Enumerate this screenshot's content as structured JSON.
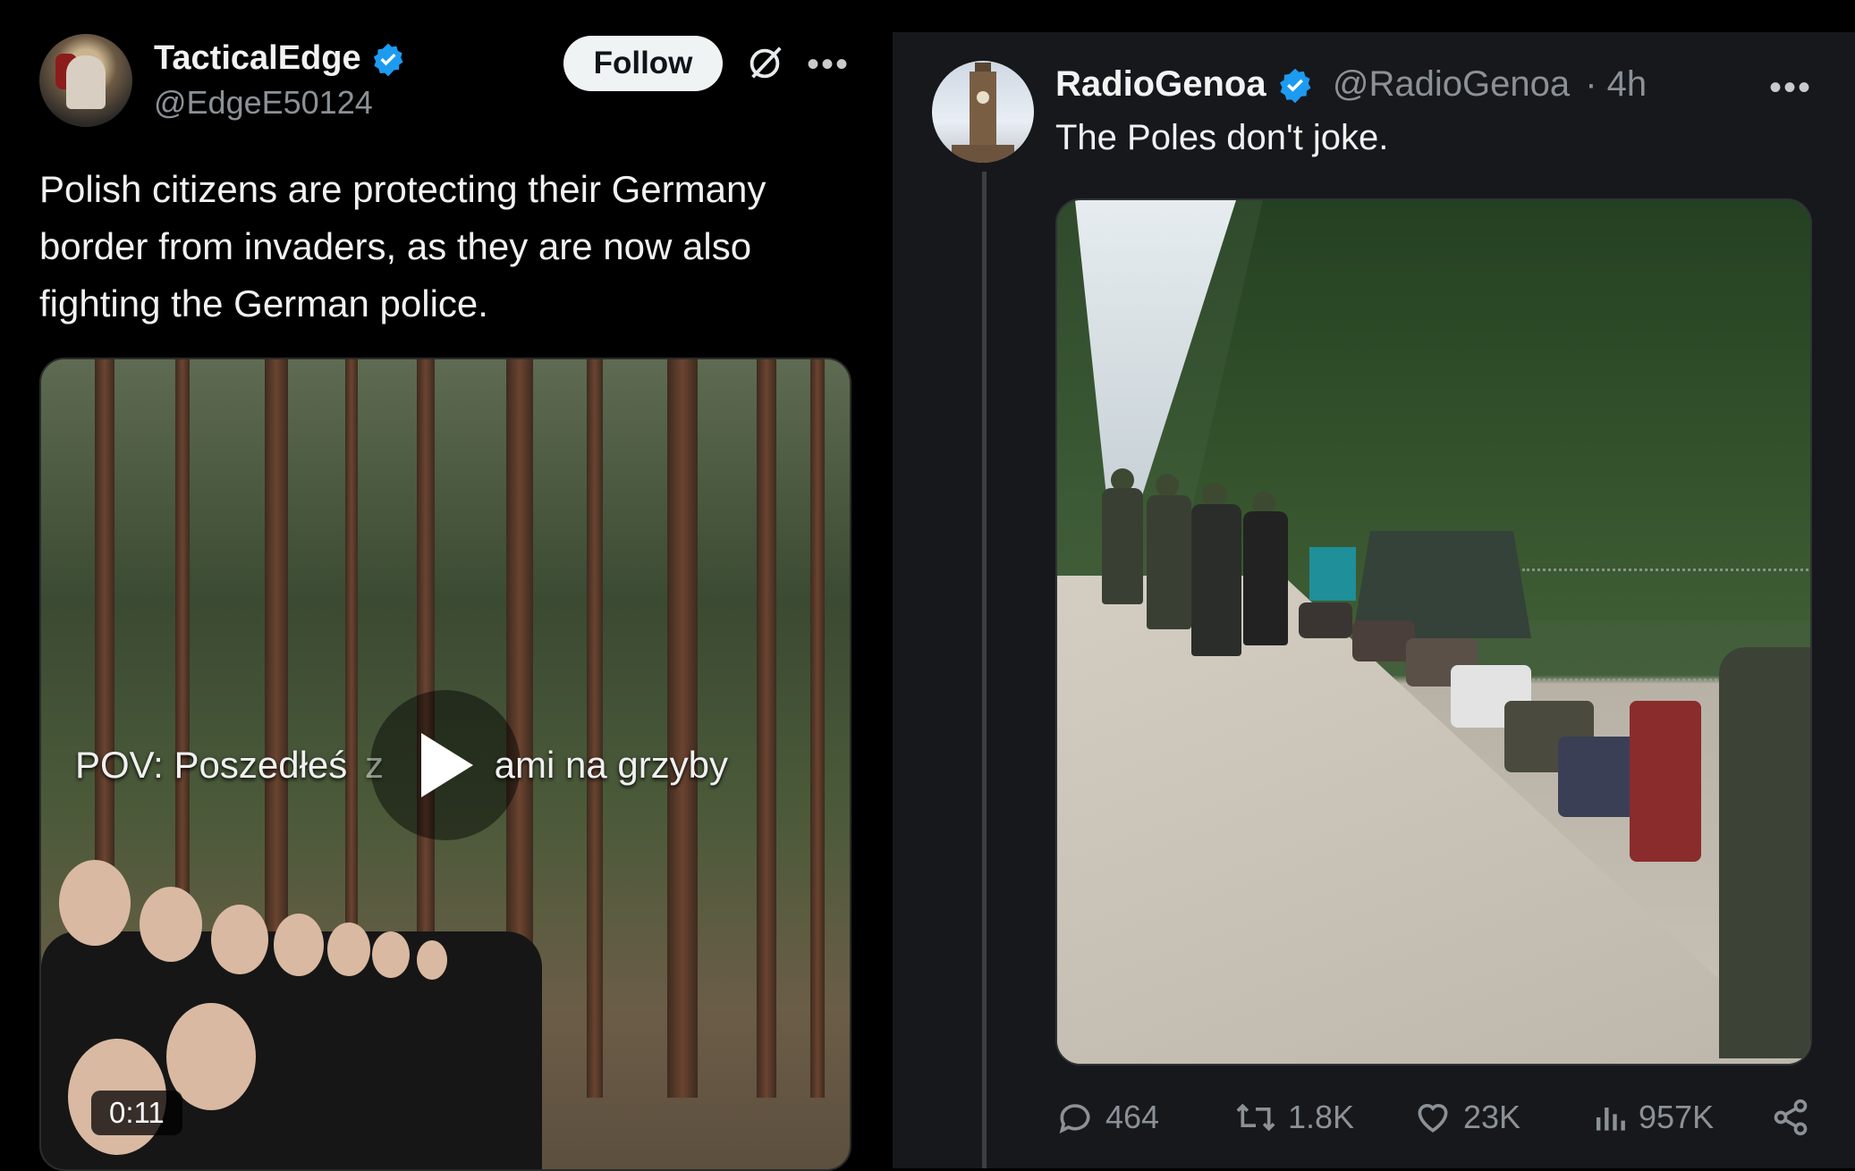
{
  "left_tweet": {
    "display_name": "TacticalEdge",
    "handle": "@EdgeE50124",
    "verified": true,
    "follow_label": "Follow",
    "text": "Polish citizens are protecting their Germany border from invaders, as they are now also fighting the German police.",
    "video": {
      "overlay_text": "POV: Poszedłeś z kolegami na grzyby",
      "overlay_visible_left": "POV: Poszedłeś",
      "overlay_visible_z": "z",
      "overlay_visible_right": "ami na grzyby",
      "duration": "0:11"
    }
  },
  "right_tweet": {
    "display_name": "RadioGenoa",
    "handle": "@RadioGenoa",
    "time": "· 4h",
    "verified": true,
    "text": "The Poles don't joke.",
    "stats": {
      "replies": "464",
      "reposts": "1.8K",
      "likes": "23K",
      "views": "957K"
    }
  },
  "colors": {
    "background": "#000000",
    "card": "#16181c",
    "verified": "#1d9bf0",
    "muted": "#8b9196",
    "text": "#e7e9ea"
  },
  "icons": [
    "verified-badge-icon",
    "grok-icon",
    "more-icon",
    "play-icon",
    "reply-icon",
    "repost-icon",
    "like-icon",
    "views-icon",
    "share-icon"
  ]
}
